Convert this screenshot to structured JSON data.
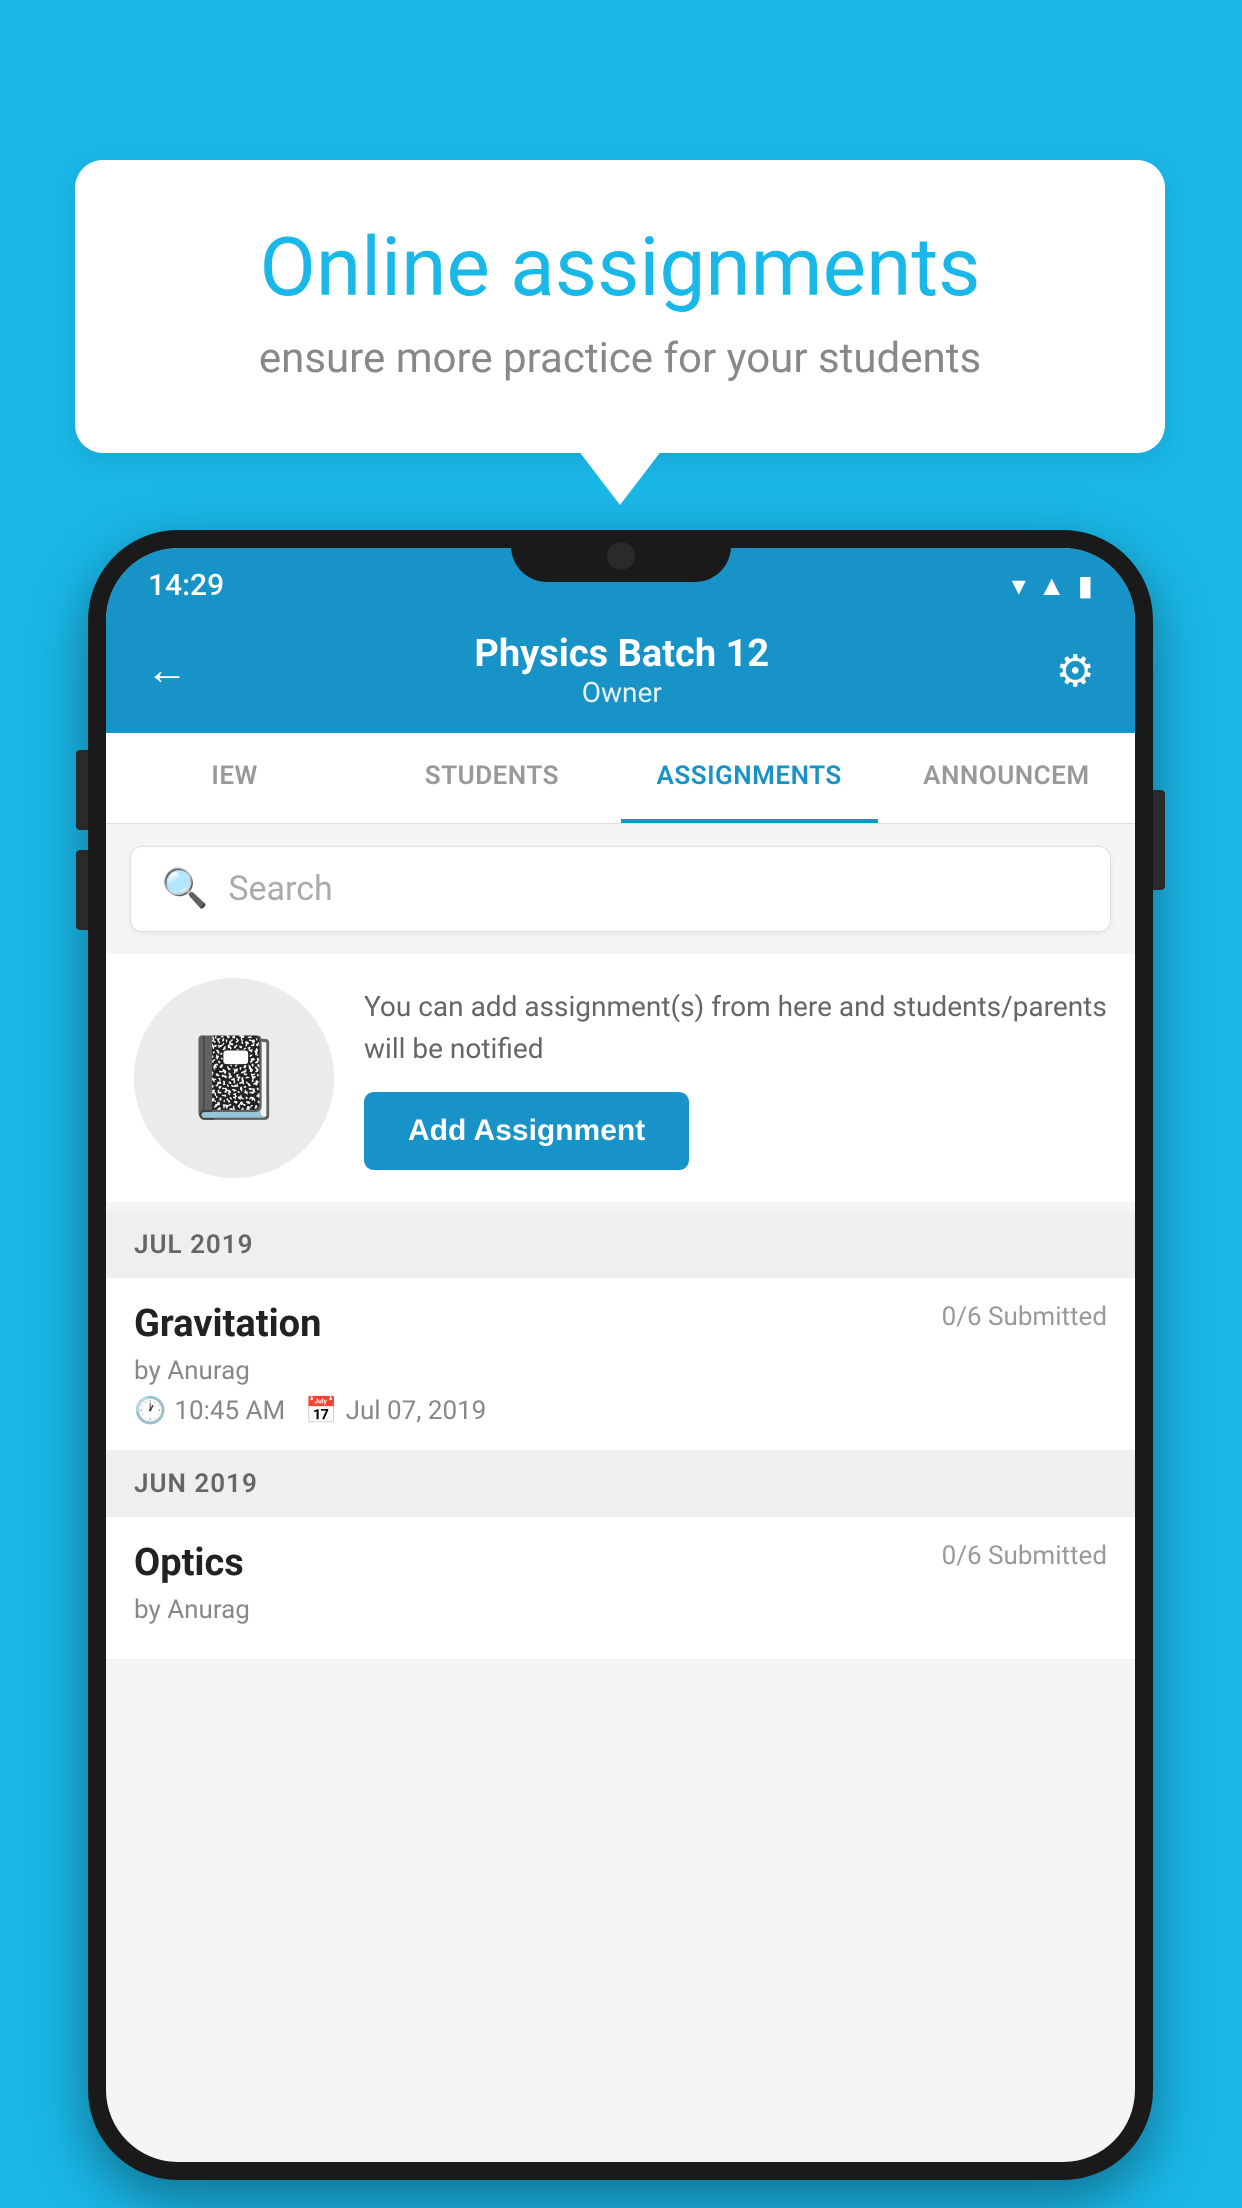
{
  "background_color": "#1ab8e8",
  "bubble": {
    "title": "Online assignments",
    "subtitle": "ensure more practice for your students"
  },
  "phone": {
    "status_bar": {
      "time": "14:29",
      "icons": [
        "wifi",
        "signal",
        "battery"
      ]
    },
    "header": {
      "title": "Physics Batch 12",
      "subtitle": "Owner",
      "back_label": "←",
      "gear_label": "⚙"
    },
    "tabs": [
      {
        "label": "IEW",
        "active": false
      },
      {
        "label": "STUDENTS",
        "active": false
      },
      {
        "label": "ASSIGNMENTS",
        "active": true
      },
      {
        "label": "ANNOUNCEM",
        "active": false
      }
    ],
    "search": {
      "placeholder": "Search"
    },
    "promo": {
      "description": "You can add assignment(s) from here and students/parents will be notified",
      "button_label": "Add Assignment"
    },
    "sections": [
      {
        "month_label": "JUL 2019",
        "assignments": [
          {
            "name": "Gravitation",
            "submitted": "0/6 Submitted",
            "by": "by Anurag",
            "time": "10:45 AM",
            "date": "Jul 07, 2019"
          }
        ]
      },
      {
        "month_label": "JUN 2019",
        "assignments": [
          {
            "name": "Optics",
            "submitted": "0/6 Submitted",
            "by": "by Anurag",
            "time": "",
            "date": ""
          }
        ]
      }
    ]
  }
}
